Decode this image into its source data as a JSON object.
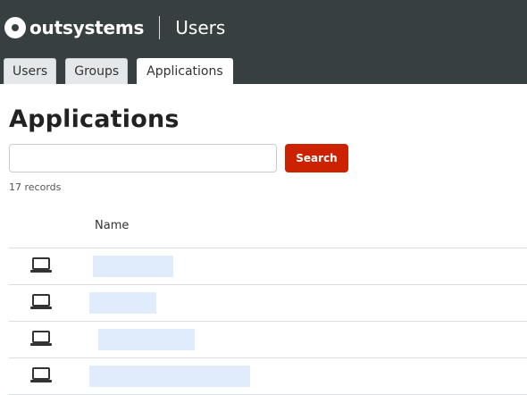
{
  "header": {
    "logo_text": "outsystems",
    "app_title": "Users"
  },
  "tabs": [
    {
      "label": "Users",
      "active": false
    },
    {
      "label": "Groups",
      "active": false
    },
    {
      "label": "Applications",
      "active": true
    }
  ],
  "main": {
    "title": "Applications",
    "search": {
      "value": "",
      "placeholder": "",
      "button_label": "Search"
    },
    "records_text": "17 records",
    "column_name": "Name",
    "rows": [
      {
        "icon": "laptop-icon",
        "name": ""
      },
      {
        "icon": "laptop-icon",
        "name": ""
      },
      {
        "icon": "laptop-icon",
        "name": ""
      },
      {
        "icon": "laptop-icon",
        "name": ""
      }
    ]
  },
  "colors": {
    "topbar": "#383f40",
    "search_button": "#cc2200",
    "tab_inactive": "#e5e8ea"
  }
}
